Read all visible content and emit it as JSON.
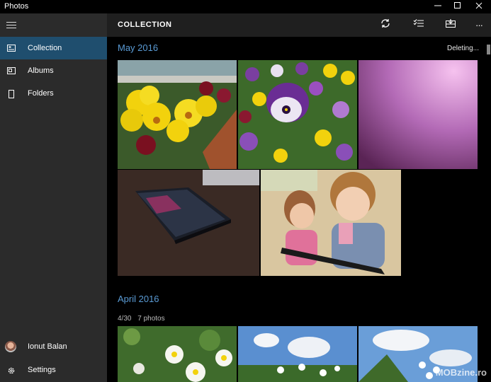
{
  "window": {
    "app_title": "Photos",
    "minimize_icon": "minimize-icon",
    "maximize_icon": "maximize-icon",
    "close_icon": "close-icon"
  },
  "sidebar": {
    "menu_icon": "hamburger-icon",
    "items": [
      {
        "label": "Collection",
        "icon": "collection-icon",
        "active": true
      },
      {
        "label": "Albums",
        "icon": "albums-icon",
        "active": false
      },
      {
        "label": "Folders",
        "icon": "folders-icon",
        "active": false
      }
    ],
    "user_name": "Ionut Balan",
    "settings_label": "Settings"
  },
  "header": {
    "title": "COLLECTION",
    "actions": [
      "refresh-icon",
      "select-icon",
      "import-icon",
      "more-icon"
    ],
    "more_glyph": "···"
  },
  "sections": [
    {
      "month": "May 2016",
      "status": "Deleting..."
    },
    {
      "month": "April 2016",
      "date": "4/30",
      "count": "7 photos"
    }
  ],
  "watermark": "MOBzine.ro",
  "colors": {
    "accent": "#5a9bd5",
    "sidebar_bg": "#2b2b2b",
    "active_item_bg": "#1f4e6e",
    "topbar_bg": "#1f1f1f"
  }
}
